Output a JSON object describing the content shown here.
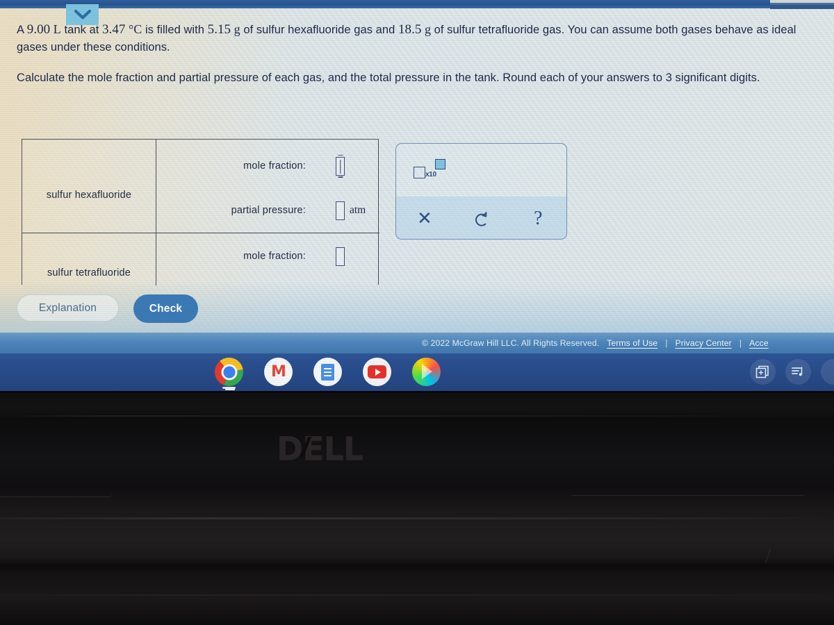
{
  "browser": {
    "collapse_icon": "chevron-down-icon"
  },
  "problem": {
    "line1_a": "A ",
    "volume": "9.00",
    "volume_unit": " L",
    "line1_b": " tank at ",
    "temperature": "3.47",
    "temperature_unit": " °C",
    "line1_c": " is filled with ",
    "mass1": "5.15",
    "mass1_unit": " g",
    "line1_d": " of sulfur hexafluoride gas and ",
    "mass2": "18.5",
    "mass2_unit": " g",
    "line1_e": " of sulfur tetrafluoride gas. You can assume both gases behave as ideal gases under these conditions.",
    "paragraph2_a": "Calculate the mole fraction and partial pressure of each gas, and the total pressure in the tank. Round each of your answers to ",
    "sig_figs": "3",
    "paragraph2_b": " significant digits."
  },
  "answer_table": {
    "rows": [
      {
        "gas": "sulfur hexafluoride",
        "fields": [
          {
            "label": "mole fraction:",
            "value": "",
            "unit": "",
            "focused": true
          },
          {
            "label": "partial pressure:",
            "value": "",
            "unit": "atm",
            "focused": false
          }
        ]
      },
      {
        "gas": "sulfur tetrafluoride",
        "fields": [
          {
            "label": "mole fraction:",
            "value": "",
            "unit": "",
            "focused": false
          }
        ]
      }
    ]
  },
  "sci_panel": {
    "x10_label": "x10",
    "x10_icon": "scientific-notation-icon",
    "buttons": [
      {
        "name": "clear-button",
        "glyph": "✕",
        "icon": "close-icon"
      },
      {
        "name": "undo-button",
        "glyph": "↺",
        "icon": "undo-icon"
      },
      {
        "name": "help-button",
        "glyph": "?",
        "icon": "question-mark-icon"
      }
    ]
  },
  "actions": {
    "explanation_label": "Explanation",
    "check_label": "Check"
  },
  "footer": {
    "copyright": "© 2022 McGraw Hill LLC. All Rights Reserved.",
    "links": [
      {
        "label": "Terms of Use"
      },
      {
        "label": "Privacy Center"
      },
      {
        "label": "Acce"
      }
    ],
    "separator": "|"
  },
  "shelf": {
    "apps": [
      {
        "name": "chrome",
        "label": "Chrome"
      },
      {
        "name": "gmail",
        "label": "Gmail",
        "glyph": "M"
      },
      {
        "name": "docs",
        "label": "Docs"
      },
      {
        "name": "youtube",
        "label": "YouTube"
      },
      {
        "name": "play-store",
        "label": "Play Store"
      }
    ],
    "tray": [
      {
        "name": "screen-capture",
        "glyph": "⧉"
      },
      {
        "name": "media-controls",
        "glyph": "♪"
      }
    ]
  },
  "hardware": {
    "brand_d": "D",
    "brand_e": "E",
    "brand_ll": "LL"
  },
  "colors": {
    "accent_blue": "#3b7ab5",
    "text_navy": "#1d2a4a",
    "panel_border": "#6e8fb8",
    "shelf_blue": "#2a4e8e",
    "footer_blue": "#4f86bb",
    "chevron_bg": "#7ec4e0"
  }
}
